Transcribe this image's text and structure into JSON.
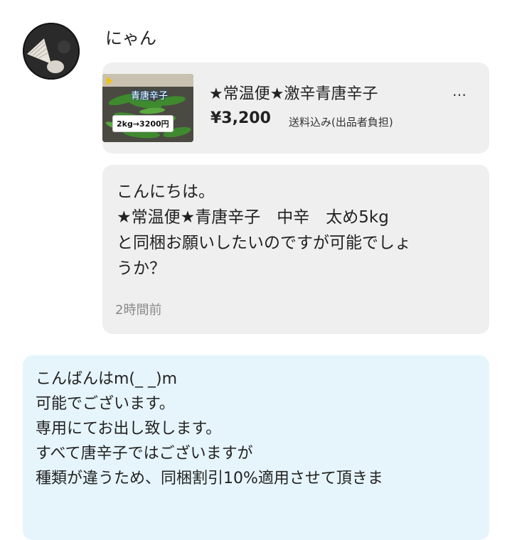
{
  "user": {
    "name": "にゃん"
  },
  "product": {
    "thumbnail_title": "青唐辛子",
    "thumbnail_tag": "2kg→3200円",
    "name": "★常温便★激辛青唐辛子",
    "more": "…",
    "price": "¥3,200",
    "shipping": "送料込み(出品者負担)"
  },
  "messages": [
    {
      "side": "received",
      "text": "こんにちは。\n★常温便★青唐辛子　中辛　太め5kg\nと同梱お願いしたいのですが可能でしょ\nうか？",
      "time": "2時間前"
    },
    {
      "side": "sent",
      "text": "こんばんはm(_ _)m\n可能でございます。\n専用にてお出し致します。\nすべて唐辛子ではございますが\n種類が違うため、同梱割引10%適用させて頂きま"
    }
  ]
}
